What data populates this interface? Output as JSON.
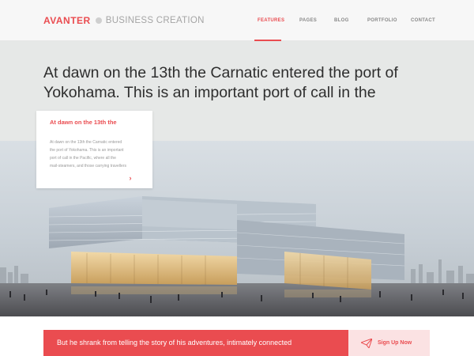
{
  "brand": {
    "name": "AVANTER",
    "tagline": "BUSINESS CREATION"
  },
  "nav": {
    "items": [
      {
        "label": "FEATURES",
        "active": true
      },
      {
        "label": "PAGES",
        "active": false
      },
      {
        "label": "BLOG",
        "active": false
      },
      {
        "label": "PORTFOLIO",
        "active": false
      },
      {
        "label": "CONTACT",
        "active": false
      }
    ]
  },
  "hero": {
    "headline_line1": "At dawn on the 13th the Carnatic entered the port of",
    "headline_line2": "Yokohama.  This is an important port of call in the"
  },
  "card": {
    "title": "At dawn on the 13th the",
    "body_lines": [
      "At dawn on the 13th the Carnatic entered",
      "the port of Yokohama.  This is an important",
      "port of call in the Pacific, where all the",
      "mail-steamers, and those carrying travellers"
    ],
    "arrow_icon": "chevron-right-icon"
  },
  "cta": {
    "text": "But he shrank from telling the story of his adventures, intimately connected",
    "signup_label": "Sign Up Now",
    "signup_icon": "paper-plane-icon"
  },
  "colors": {
    "accent": "#ea4c50",
    "hero_bg": "#e6e8e7",
    "signup_bg": "#fbe2e3"
  }
}
